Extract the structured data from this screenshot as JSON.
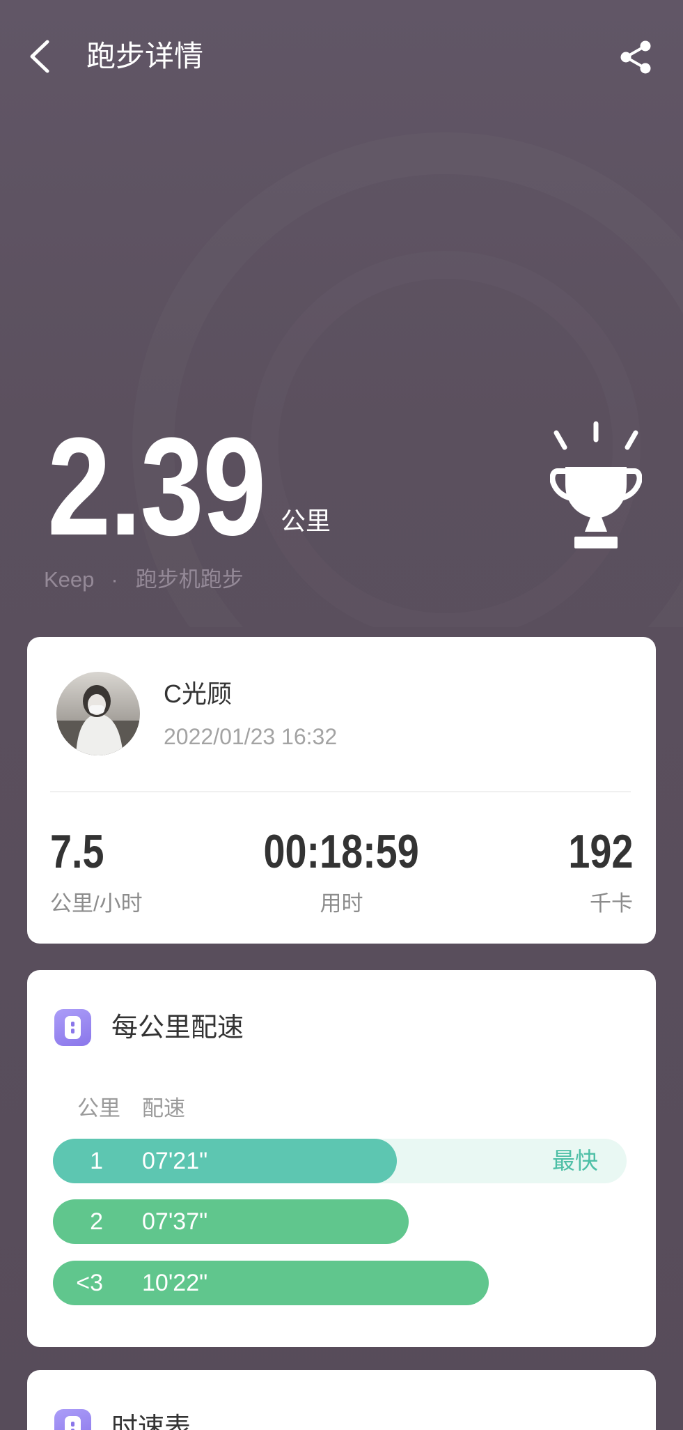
{
  "header": {
    "title": "跑步详情"
  },
  "icons": {
    "back": "chevron-left-icon",
    "share": "share-icon",
    "trophy": "trophy-icon",
    "pace": "pace-icon",
    "speed": "speedometer-icon"
  },
  "summary": {
    "distance": "2.39",
    "unit": "公里",
    "source": "Keep",
    "separator": "·",
    "activity": "跑步机跑步"
  },
  "profile": {
    "name": "C光顾",
    "datetime": "2022/01/23 16:32"
  },
  "stats": [
    {
      "value": "7.5",
      "label": "公里/小时"
    },
    {
      "value": "00:18:59",
      "label": "用时"
    },
    {
      "value": "192",
      "label": "千卡"
    }
  ],
  "pace": {
    "title": "每公里配速",
    "col_km": "公里",
    "col_pace": "配速",
    "fastest_label": "最快",
    "rows": [
      {
        "km": "1",
        "pace": "07'21\"",
        "fill": 0.6,
        "fastest": true
      },
      {
        "km": "2",
        "pace": "07'37\"",
        "fill": 0.62,
        "fastest": false
      },
      {
        "km": "<3",
        "pace": "10'22\"",
        "fill": 0.76,
        "fastest": false
      }
    ]
  },
  "speed": {
    "title": "时速表"
  },
  "colors": {
    "background": "#5a4f5d",
    "fastest_bar": "#5dc6b1",
    "bar": "#60c68d",
    "fastest_track": "#e9f8f3",
    "fastest_text": "#4dbfa6",
    "icon_purple": "#8a76ea"
  }
}
